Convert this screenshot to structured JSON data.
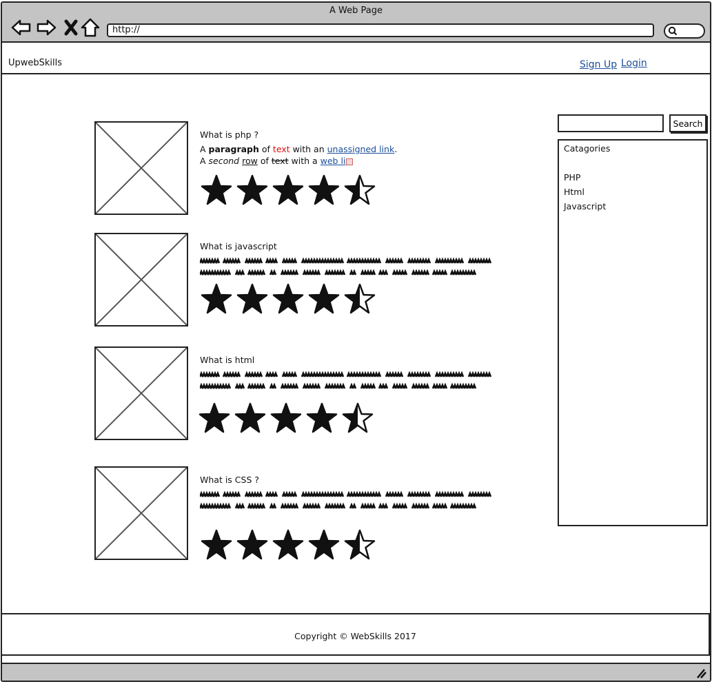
{
  "window": {
    "title": "A Web Page"
  },
  "browser": {
    "url": "http://",
    "icons": [
      "back-arrow-icon",
      "forward-arrow-icon",
      "close-x-icon",
      "home-icon",
      "search-icon"
    ]
  },
  "header": {
    "brand": "UpwebSkills",
    "signup_label": "Sign Up",
    "login_label": "Login"
  },
  "articles": [
    {
      "title": "What is php ?",
      "para1": {
        "a": "A ",
        "bold": "paragraph",
        "of": " of ",
        "red": "text",
        "with": " with an ",
        "link": "unassigned link",
        "end": "."
      },
      "para2": {
        "a": "A ",
        "italic": "second",
        "sp": " ",
        "ul": "row",
        "of": " of ",
        "strike": "text",
        "with": " with a ",
        "link": "web li"
      },
      "rating": 4.5
    },
    {
      "title": "What is javascript",
      "rating": 4.5
    },
    {
      "title": "What is html",
      "rating": 4.5
    },
    {
      "title": "What is CSS ?",
      "rating": 4.5
    }
  ],
  "sidebar": {
    "search_button": "Search",
    "categories_title": "Catagories",
    "categories": [
      "PHP",
      "Html",
      "Javascript"
    ]
  },
  "footer": {
    "text": "Copyright © WebSkills 2017"
  },
  "colors": {
    "link": "#1a4e9b",
    "red_text": "#d11111",
    "chrome": "#c4c4c4"
  }
}
